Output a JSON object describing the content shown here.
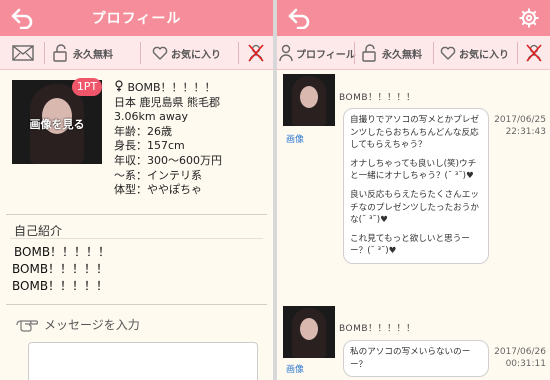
{
  "profile_screen": {
    "header_title": "プロフィール",
    "toolbar": {
      "mail_label": "",
      "free_label": "永久無料",
      "fav_label": "お気に入り"
    },
    "photo_overlay": "画像を見る",
    "pt_badge": "1PT",
    "info": {
      "name": "BOMB！！！！！",
      "location": "日本 鹿児島県 熊毛郡",
      "distance": "3.06km away",
      "age": "年齢：26歳",
      "height": "身長：157cm",
      "income": "年収：300～600万円",
      "type": "～系：インテリ系",
      "body": "体型：ややぽちゃ"
    },
    "intro_title": "自己紹介",
    "intro_lines": [
      "BOMB！！！！！",
      "BOMB！！！！！",
      "BOMB！！！！！"
    ],
    "message_label": "メッセージを入力"
  },
  "chat_screen": {
    "toolbar": {
      "profile_label": "プロフィール",
      "free_label": "永久無料",
      "fav_label": "お気に入り"
    },
    "messages": [
      {
        "name": "BOMB！！！！！",
        "image_link": "画像",
        "paragraphs": [
          "自撮りでアソコの写メとかプレゼンツしたらおちんちんどんな反応してもらえちゃう？",
          "オナしちゃっても良いし(笑)ウチと一緒にオナしちゃう？(˘ ³˘)♥",
          "良い反応もらえたらたくさんエッチなのプレゼンツしたったおうかな(˘ ³˘)♥",
          "これ見てもっと欲しいと思うーー？(˘ ³˘)♥"
        ],
        "date": "2017/06/25",
        "time": "22:31:43"
      },
      {
        "name": "BOMB！！！！！",
        "image_link": "画像",
        "paragraphs": [
          "私のアソコの写メいらないのーー？"
        ],
        "date": "2017/06/26",
        "time": "00:31:11"
      }
    ]
  },
  "colors": {
    "header": "#f58e9a",
    "toolbar": "#fde8ea",
    "badge": "#f0566a",
    "background": "#fffaf0",
    "link": "#2f7ad1"
  }
}
